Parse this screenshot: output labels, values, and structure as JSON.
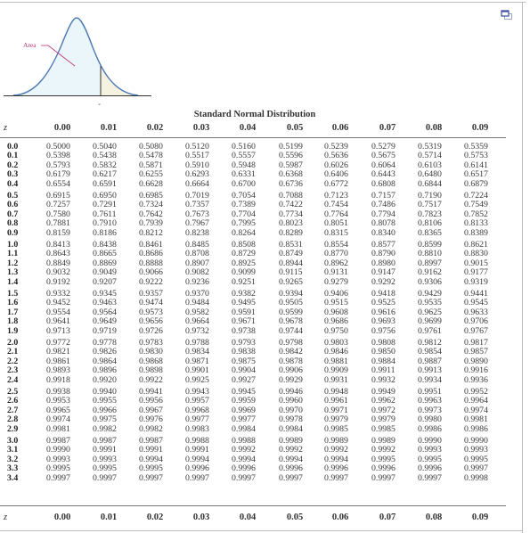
{
  "figure": {
    "area_label": "Area",
    "z_label": "z",
    "colors": {
      "curve": "#4a78b5",
      "area_fill": "#eaf6fa",
      "tail_fill": "#f5f3df",
      "label": "#c2347e"
    }
  },
  "title": "Standard Normal Distribution",
  "columns": {
    "z_label": "z",
    "headers": [
      "0.00",
      "0.01",
      "0.02",
      "0.03",
      "0.04",
      "0.05",
      "0.06",
      "0.07",
      "0.08",
      "0.09"
    ]
  },
  "chart_data": {
    "type": "table",
    "title": "Standard Normal Distribution",
    "row_label": "z",
    "columns": [
      "0.00",
      "0.01",
      "0.02",
      "0.03",
      "0.04",
      "0.05",
      "0.06",
      "0.07",
      "0.08",
      "0.09"
    ],
    "rows": [
      {
        "z": "0.0",
        "values": [
          "0.5000",
          "0.5040",
          "0.5080",
          "0.5120",
          "0.5160",
          "0.5199",
          "0.5239",
          "0.5279",
          "0.5319",
          "0.5359"
        ]
      },
      {
        "z": "0.1",
        "values": [
          "0.5398",
          "0.5438",
          "0.5478",
          "0.5517",
          "0.5557",
          "0.5596",
          "0.5636",
          "0.5675",
          "0.5714",
          "0.5753"
        ]
      },
      {
        "z": "0.2",
        "values": [
          "0.5793",
          "0.5832",
          "0.5871",
          "0.5910",
          "0.5948",
          "0.5987",
          "0.6026",
          "0.6064",
          "0.6103",
          "0.6141"
        ]
      },
      {
        "z": "0.3",
        "values": [
          "0.6179",
          "0.6217",
          "0.6255",
          "0.6293",
          "0.6331",
          "0.6368",
          "0.6406",
          "0.6443",
          "0.6480",
          "0.6517"
        ]
      },
      {
        "z": "0.4",
        "values": [
          "0.6554",
          "0.6591",
          "0.6628",
          "0.6664",
          "0.6700",
          "0.6736",
          "0.6772",
          "0.6808",
          "0.6844",
          "0.6879"
        ]
      },
      {
        "z": "0.5",
        "values": [
          "0.6915",
          "0.6950",
          "0.6985",
          "0.7019",
          "0.7054",
          "0.7088",
          "0.7123",
          "0.7157",
          "0.7190",
          "0.7224"
        ]
      },
      {
        "z": "0.6",
        "values": [
          "0.7257",
          "0.7291",
          "0.7324",
          "0.7357",
          "0.7389",
          "0.7422",
          "0.7454",
          "0.7486",
          "0.7517",
          "0.7549"
        ]
      },
      {
        "z": "0.7",
        "values": [
          "0.7580",
          "0.7611",
          "0.7642",
          "0.7673",
          "0.7704",
          "0.7734",
          "0.7764",
          "0.7794",
          "0.7823",
          "0.7852"
        ]
      },
      {
        "z": "0.8",
        "values": [
          "0.7881",
          "0.7910",
          "0.7939",
          "0.7967",
          "0.7995",
          "0.8023",
          "0.8051",
          "0.8078",
          "0.8106",
          "0.8133"
        ]
      },
      {
        "z": "0.9",
        "values": [
          "0.8159",
          "0.8186",
          "0.8212",
          "0.8238",
          "0.8264",
          "0.8289",
          "0.8315",
          "0.8340",
          "0.8365",
          "0.8389"
        ]
      },
      {
        "z": "1.0",
        "values": [
          "0.8413",
          "0.8438",
          "0.8461",
          "0.8485",
          "0.8508",
          "0.8531",
          "0.8554",
          "0.8577",
          "0.8599",
          "0.8621"
        ]
      },
      {
        "z": "1.1",
        "values": [
          "0.8643",
          "0.8665",
          "0.8686",
          "0.8708",
          "0.8729",
          "0.8749",
          "0.8770",
          "0.8790",
          "0.8810",
          "0.8830"
        ]
      },
      {
        "z": "1.2",
        "values": [
          "0.8849",
          "0.8869",
          "0.8888",
          "0.8907",
          "0.8925",
          "0.8944",
          "0.8962",
          "0.8980",
          "0.8997",
          "0.9015"
        ]
      },
      {
        "z": "1.3",
        "values": [
          "0.9032",
          "0.9049",
          "0.9066",
          "0.9082",
          "0.9099",
          "0.9115",
          "0.9131",
          "0.9147",
          "0.9162",
          "0.9177"
        ]
      },
      {
        "z": "1.4",
        "values": [
          "0.9192",
          "0.9207",
          "0.9222",
          "0.9236",
          "0.9251",
          "0.9265",
          "0.9279",
          "0.9292",
          "0.9306",
          "0.9319"
        ]
      },
      {
        "z": "1.5",
        "values": [
          "0.9332",
          "0.9345",
          "0.9357",
          "0.9370",
          "0.9382",
          "0.9394",
          "0.9406",
          "0.9418",
          "0.9429",
          "0.9441"
        ]
      },
      {
        "z": "1.6",
        "values": [
          "0.9452",
          "0.9463",
          "0.9474",
          "0.9484",
          "0.9495",
          "0.9505",
          "0.9515",
          "0.9525",
          "0.9535",
          "0.9545"
        ]
      },
      {
        "z": "1.7",
        "values": [
          "0.9554",
          "0.9564",
          "0.9573",
          "0.9582",
          "0.9591",
          "0.9599",
          "0.9608",
          "0.9616",
          "0.9625",
          "0.9633"
        ]
      },
      {
        "z": "1.8",
        "values": [
          "0.9641",
          "0.9649",
          "0.9656",
          "0.9664",
          "0.9671",
          "0.9678",
          "0.9686",
          "0.9693",
          "0.9699",
          "0.9706"
        ]
      },
      {
        "z": "1.9",
        "values": [
          "0.9713",
          "0.9719",
          "0.9726",
          "0.9732",
          "0.9738",
          "0.9744",
          "0.9750",
          "0.9756",
          "0.9761",
          "0.9767"
        ]
      },
      {
        "z": "2.0",
        "values": [
          "0.9772",
          "0.9778",
          "0.9783",
          "0.9788",
          "0.9793",
          "0.9798",
          "0.9803",
          "0.9808",
          "0.9812",
          "0.9817"
        ]
      },
      {
        "z": "2.1",
        "values": [
          "0.9821",
          "0.9826",
          "0.9830",
          "0.9834",
          "0.9838",
          "0.9842",
          "0.9846",
          "0.9850",
          "0.9854",
          "0.9857"
        ]
      },
      {
        "z": "2.2",
        "values": [
          "0.9861",
          "0.9864",
          "0.9868",
          "0.9871",
          "0.9875",
          "0.9878",
          "0.9881",
          "0.9884",
          "0.9887",
          "0.9890"
        ]
      },
      {
        "z": "2.3",
        "values": [
          "0.9893",
          "0.9896",
          "0.9898",
          "0.9901",
          "0.9904",
          "0.9906",
          "0.9909",
          "0.9911",
          "0.9913",
          "0.9916"
        ]
      },
      {
        "z": "2.4",
        "values": [
          "0.9918",
          "0.9920",
          "0.9922",
          "0.9925",
          "0.9927",
          "0.9929",
          "0.9931",
          "0.9932",
          "0.9934",
          "0.9936"
        ]
      },
      {
        "z": "2.5",
        "values": [
          "0.9938",
          "0.9940",
          "0.9941",
          "0.9943",
          "0.9945",
          "0.9946",
          "0.9948",
          "0.9949",
          "0.9951",
          "0.9952"
        ]
      },
      {
        "z": "2.6",
        "values": [
          "0.9953",
          "0.9955",
          "0.9956",
          "0.9957",
          "0.9959",
          "0.9960",
          "0.9961",
          "0.9962",
          "0.9963",
          "0.9964"
        ]
      },
      {
        "z": "2.7",
        "values": [
          "0.9965",
          "0.9966",
          "0.9967",
          "0.9968",
          "0.9969",
          "0.9970",
          "0.9971",
          "0.9972",
          "0.9973",
          "0.9974"
        ]
      },
      {
        "z": "2.8",
        "values": [
          "0.9974",
          "0.9975",
          "0.9976",
          "0.9977",
          "0.9977",
          "0.9978",
          "0.9979",
          "0.9979",
          "0.9980",
          "0.9981"
        ]
      },
      {
        "z": "2.9",
        "values": [
          "0.9981",
          "0.9982",
          "0.9982",
          "0.9983",
          "0.9984",
          "0.9984",
          "0.9985",
          "0.9985",
          "0.9986",
          "0.9986"
        ]
      },
      {
        "z": "3.0",
        "values": [
          "0.9987",
          "0.9987",
          "0.9987",
          "0.9988",
          "0.9988",
          "0.9989",
          "0.9989",
          "0.9989",
          "0.9990",
          "0.9990"
        ]
      },
      {
        "z": "3.1",
        "values": [
          "0.9990",
          "0.9991",
          "0.9991",
          "0.9991",
          "0.9992",
          "0.9992",
          "0.9992",
          "0.9992",
          "0.9993",
          "0.9993"
        ]
      },
      {
        "z": "3.2",
        "values": [
          "0.9993",
          "0.9993",
          "0.9994",
          "0.9994",
          "0.9994",
          "0.9994",
          "0.9994",
          "0.9995",
          "0.9995",
          "0.9995"
        ]
      },
      {
        "z": "3.3",
        "values": [
          "0.9995",
          "0.9995",
          "0.9995",
          "0.9996",
          "0.9996",
          "0.9996",
          "0.9996",
          "0.9996",
          "0.9996",
          "0.9997"
        ]
      },
      {
        "z": "3.4",
        "values": [
          "0.9997",
          "0.9997",
          "0.9997",
          "0.9997",
          "0.9997",
          "0.9997",
          "0.9997",
          "0.9997",
          "0.9997",
          "0.9998"
        ]
      }
    ]
  },
  "toolbar": {
    "popout_icon": "popout-window-icon"
  }
}
